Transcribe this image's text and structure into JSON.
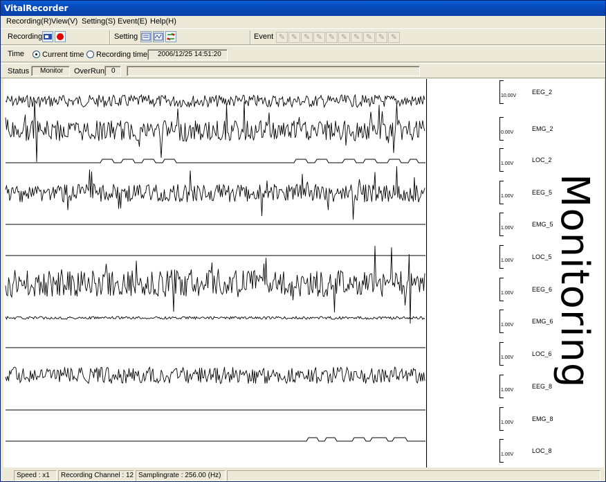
{
  "window": {
    "title": "VitalRecorder"
  },
  "menu": [
    {
      "label": "Recording(R)"
    },
    {
      "label": "View(V)"
    },
    {
      "label": "Setting(S)"
    },
    {
      "label": "Event(E)"
    },
    {
      "label": "Help(H)"
    }
  ],
  "toolbar": {
    "recording_label": "Recording",
    "setting_label": "Setting",
    "event_label": "Event",
    "event_button_count_visible": 10
  },
  "time": {
    "label": "Time",
    "current_time_label": "Current time",
    "recording_time_label": "Recording time",
    "selected": "current",
    "value": "2006/12/25 14:51:20"
  },
  "status": {
    "label": "Status",
    "value": "Monitor",
    "overrun_label": "OverRun",
    "overrun_value": "0"
  },
  "channels": [
    {
      "name": "EEG_2",
      "scale": "10.00V"
    },
    {
      "name": "EMG_2",
      "scale": "0.00V"
    },
    {
      "name": "LOC_2",
      "scale": "1.00V"
    },
    {
      "name": "EEG_5",
      "scale": "1.00V"
    },
    {
      "name": "EMG_5",
      "scale": "1.00V"
    },
    {
      "name": "LOC_5",
      "scale": "1.00V"
    },
    {
      "name": "EEG_6",
      "scale": "1.00V"
    },
    {
      "name": "EMG_6",
      "scale": "1.00V"
    },
    {
      "name": "LOC_6",
      "scale": "1.00V"
    },
    {
      "name": "EEG_8",
      "scale": "1.00V"
    },
    {
      "name": "EMG_8",
      "scale": "1.00V"
    },
    {
      "name": "LOC_8",
      "scale": "1.00V"
    }
  ],
  "overlay_text": "Monitoring",
  "statusbar": {
    "speed": "Speed : x1",
    "recording_channel": "Recording Channel :   12",
    "samplingrate": "Samplingrate : 256.00 (Hz)"
  },
  "colors": {
    "titlebar": "#0848b8",
    "record_button": "#e00000"
  }
}
